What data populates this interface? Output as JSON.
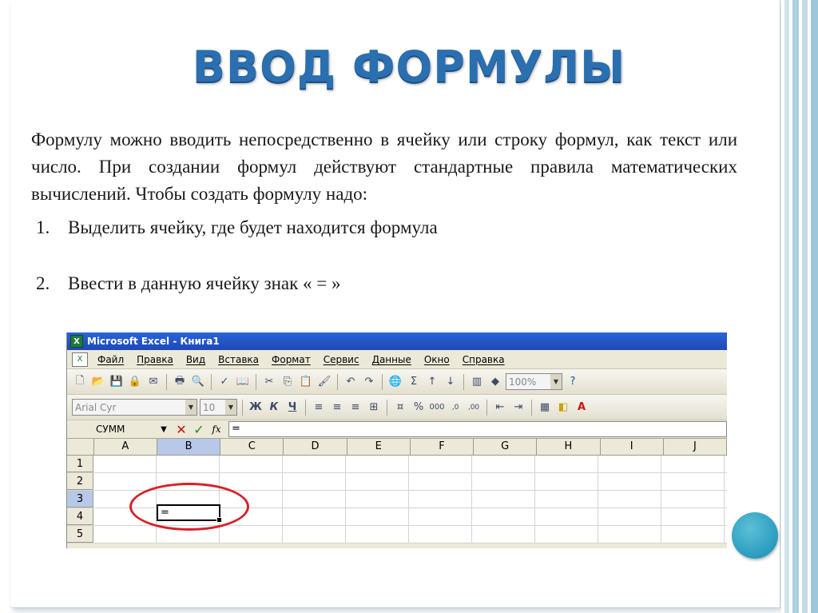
{
  "slide": {
    "title": "ВВОД ФОРМУЛЫ",
    "paragraph": "Формулу можно вводить непосредственно в ячейку или строку формул, как текст или число. При создании формул действуют стандартные правила математических вычислений. Чтобы создать формулу надо:",
    "steps": [
      {
        "num": "1.",
        "text": "Выделить ячейку, где будет находится формула"
      },
      {
        "num": "2.",
        "text": "Ввести в данную ячейку знак « = »"
      }
    ]
  },
  "excel": {
    "window_title": "Microsoft Excel - Книга1",
    "menu": [
      "Файл",
      "Правка",
      "Вид",
      "Вставка",
      "Формат",
      "Сервис",
      "Данные",
      "Окно",
      "Справка"
    ],
    "zoom": "100%",
    "font_name": "Arial Cyr",
    "font_size": "10",
    "format_buttons": {
      "bold": "Ж",
      "italic": "К",
      "underline": "Ч"
    },
    "name_box": "СУММ",
    "fx_label": "fx",
    "formula_value": "=",
    "columns": [
      "A",
      "B",
      "C",
      "D",
      "E",
      "F",
      "G",
      "H",
      "I",
      "J"
    ],
    "rows": [
      "1",
      "2",
      "3",
      "4",
      "5"
    ],
    "active_cell": {
      "ref": "B3",
      "value": "="
    }
  },
  "colors": {
    "title": "#2a6fb0",
    "highlight_ellipse": "#d8202a",
    "accent_circle": "#2a9cbf"
  }
}
